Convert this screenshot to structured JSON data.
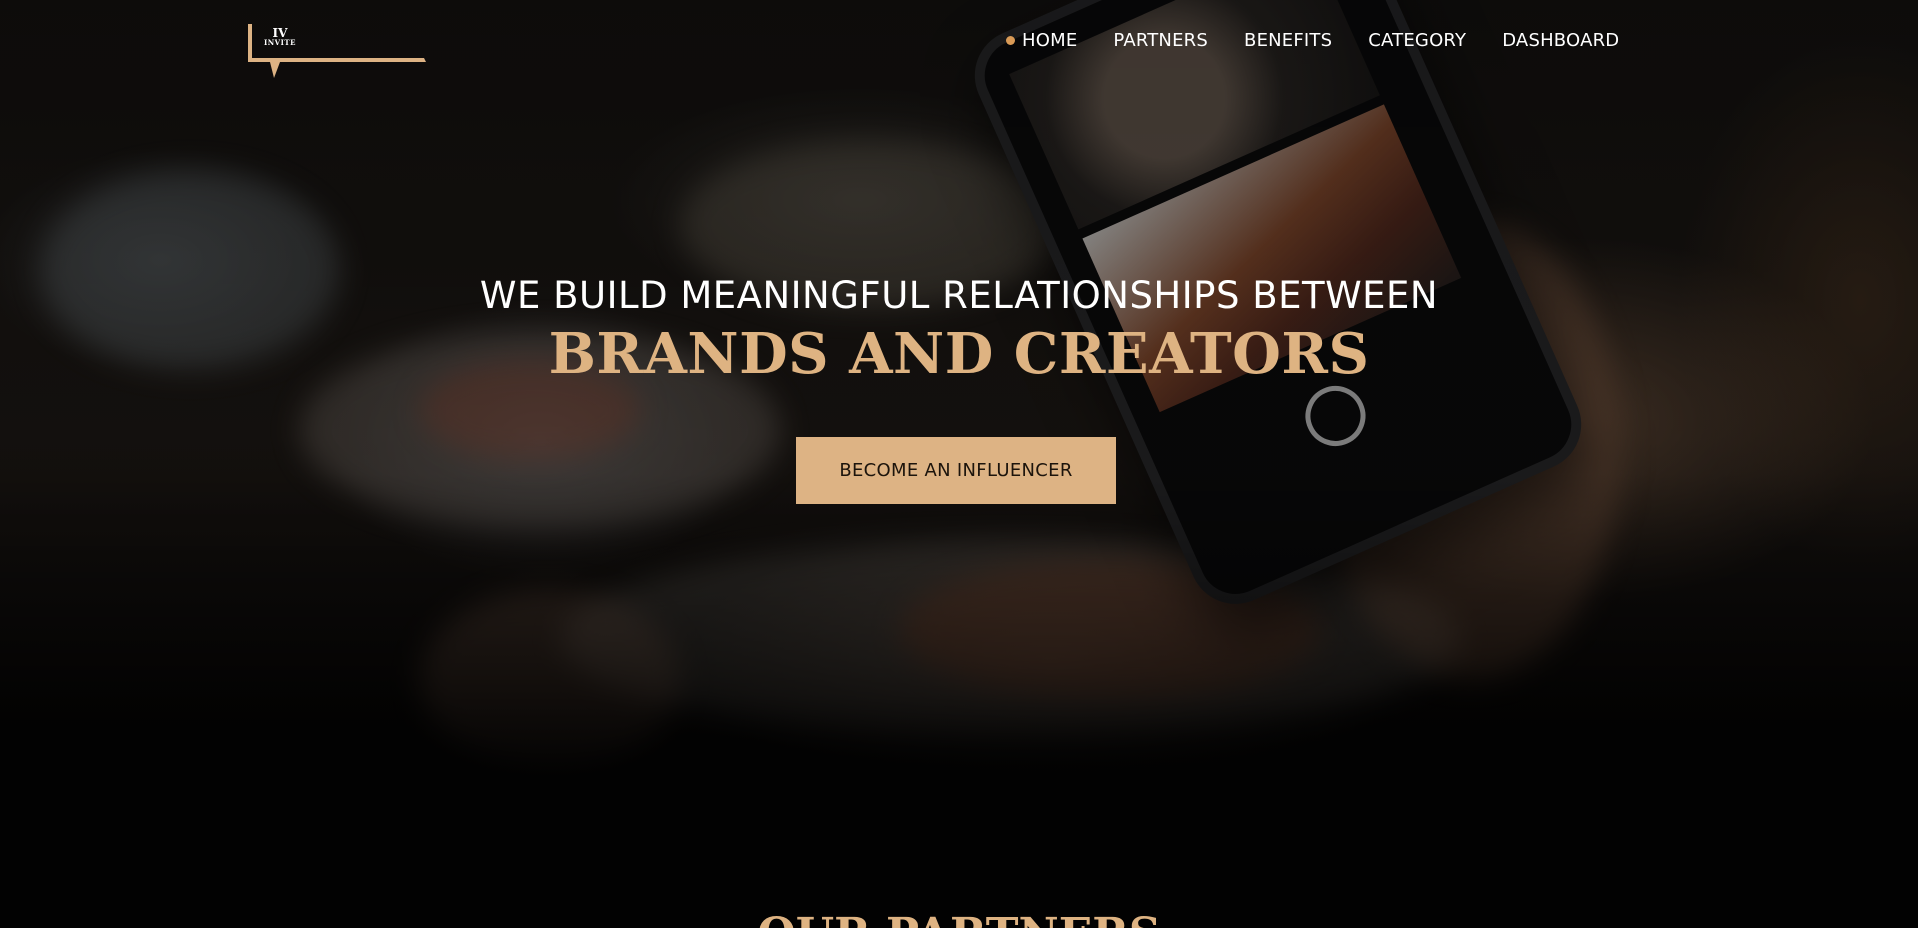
{
  "brand": {
    "logo_main": "IV",
    "logo_sub": "INVITE",
    "accent_color": "#ddb384",
    "active_dot_color": "#d99a56"
  },
  "nav": {
    "items": [
      {
        "label": "HOME",
        "active": true
      },
      {
        "label": "PARTNERS",
        "active": false
      },
      {
        "label": "BENEFITS",
        "active": false
      },
      {
        "label": "CATEGORY",
        "active": false
      },
      {
        "label": "DASHBOARD",
        "active": false
      }
    ]
  },
  "hero": {
    "headline": "WE BUILD MEANINGFUL RELATIONSHIPS BETWEEN",
    "headline_accent": "BRANDS AND CREATORS",
    "cta_label": "BECOME AN INFLUENCER"
  },
  "partners": {
    "title": "OUR PARTNERS"
  }
}
